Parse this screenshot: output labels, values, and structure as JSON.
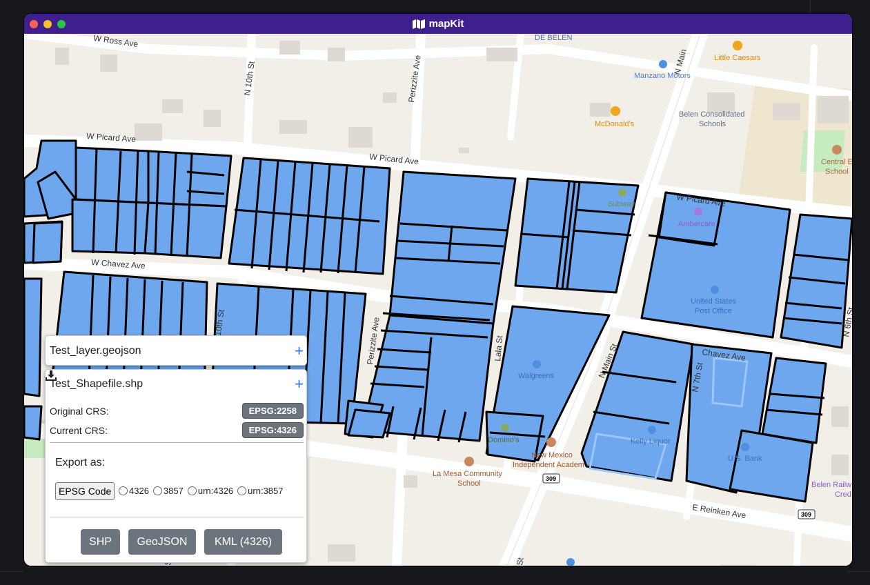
{
  "window": {
    "title": "mapKit"
  },
  "map": {
    "streets": {
      "w_ross": "W Ross Ave",
      "n_10th_top": "N 10th St",
      "perizzite_top": "Perizzite Ave",
      "n_main_top": "N Main",
      "w_picard_left": "W Picard Ave",
      "w_picard_mid": "W Picard Ave",
      "w_picard_right": "W Picard Ave",
      "w_chavez": "W Chavez Ave",
      "n_10th_mid": "N 10th St",
      "perizzite_mid": "Perizzite Ave",
      "lala": "Lala St",
      "n_main_mid": "N Main St",
      "chavez_ave": "Chavez Ave",
      "n_7th": "N 7th St",
      "n_6th": "N 6th St",
      "e_reinken": "E Reinken Ave",
      "st_bottom_left": "St",
      "st_bottom_mid": "St",
      "de_belen": "DE BELEN"
    },
    "pois": {
      "little_caesars": "Little Caesars",
      "manzano_motors": "Manzano Motors",
      "belen_consolidated_1": "Belen Consolidated",
      "belen_consolidated_2": "Schools",
      "mcdonalds": "McDonald's",
      "central_elem_1": "Central Eleme",
      "central_elem_2": "School",
      "subway": "Subway",
      "ambercare": "Ambercare",
      "post_office_1": "United States",
      "post_office_2": "Post Office",
      "walgreens": "Walgreens",
      "dominos": "Domino's",
      "nm_academy_1": "New Mexico",
      "nm_academy_2": "Independent Academ",
      "kelly_liquor": "Kelly Liquor",
      "us_bank": "U.S. Bank",
      "la_mesa_1": "La Mesa Community",
      "la_mesa_2": "School",
      "belen_railway_1": "Belen Railw",
      "belen_railway_2": "Cred"
    },
    "route_shields": {
      "left": "309",
      "right": "309"
    },
    "colors": {
      "parcel_fill": "#6ea7ee",
      "parcel_stroke": "#000000",
      "background": "#f2efe9",
      "road": "#ffffff"
    }
  },
  "layers": [
    {
      "name": "Test_layer.geojson",
      "add_label": "+"
    },
    {
      "name": "Test_Shapefile.shp",
      "add_label": "+"
    }
  ],
  "crs": {
    "original_label": "Original CRS:",
    "original_value": "EPSG:2258",
    "current_label": "Current CRS:",
    "current_value": "EPSG:4326"
  },
  "export": {
    "title": "Export as:",
    "epsg_button": "EPSG Code",
    "options": [
      "4326",
      "3857",
      "urn:4326",
      "urn:3857"
    ],
    "buttons": {
      "shp": "SHP",
      "geojson": "GeoJSON",
      "kml": "KML (4326)"
    }
  },
  "icons": {
    "title": "map-icon",
    "download": "download-icon"
  }
}
